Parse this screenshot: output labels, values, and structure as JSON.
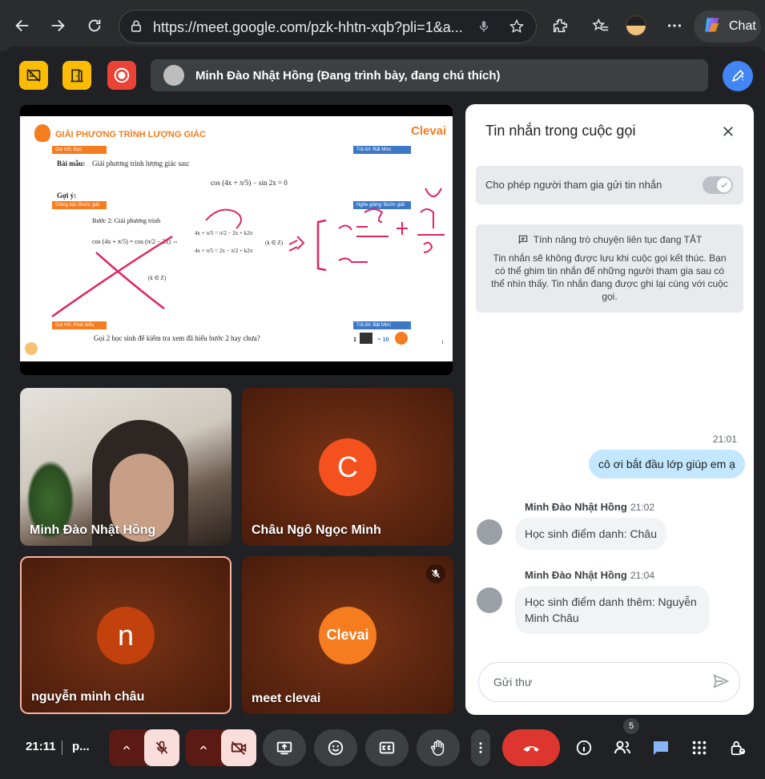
{
  "browser": {
    "url": "https://meet.google.com/pzk-hhtn-xqb?pli=1&a...",
    "copilot_label": "Chat"
  },
  "meet": {
    "presenter_text": "Minh Đào Nhật Hồng (Đang trình bày, đang chú thích)"
  },
  "slide": {
    "title": "GIẢI PHƯƠNG TRÌNH LƯỢNG GIÁC",
    "brand": "Clevai",
    "tag_goi_hs_doc": "Gọi HS: Đọc",
    "tag_tra_loi_rat_muc": "Trả lời: Rất Mức",
    "bai_mau_label": "Bài mẫu:",
    "bai_mau_text": "Giải phương trình lượng giác sau:",
    "equation": "cos (4x + π/5) − sin 2x = 0",
    "goi_y": "Gợi ý:",
    "tag_giang_bai": "Giảng bài: Bước giải",
    "tag_nghe_giang": "Nghe giảng: Bước giải",
    "step2": "Bước 2: Giải phương trình",
    "line1": "cos (4x + π/5) = cos (π/2 − 2x) ⇔",
    "case1": "4x + π/5 = π/2 − 2x + k2π",
    "case2": "4x + π/5 = 2x − π/2 + k2π",
    "k_in_z1": "(k ∈ Z)",
    "k_in_z2": "(k ∈ Z)",
    "tag_phat_bieu": "Gọi HS: Phát biểu",
    "tag_tra_loi_bat_muc": "Trả lời: Bật Mức",
    "question": "Gọi 2 học sinh để kiểm tra xem đã hiểu bước 2 hay chưa?",
    "score_left": "1",
    "score_right": "= 10",
    "page_num": "1"
  },
  "tiles": [
    {
      "name": "Minh Đào Nhật Hồng"
    },
    {
      "name": "Châu Ngô Ngọc Minh",
      "initial": "C"
    },
    {
      "name": "nguyễn minh châu",
      "initial": "n"
    },
    {
      "name": "meet clevai",
      "logo_text": "Clevai"
    }
  ],
  "chat": {
    "title": "Tin nhắn trong cuộc gọi",
    "allow_label": "Cho phép người tham gia gửi tin nhắn",
    "info_title": "Tính năng trò chuyện liên tục đang TẮT",
    "info_body": "Tin nhắn sẽ không được lưu khi cuộc gọi kết thúc. Bạn có thể ghim tin nhắn để những người tham gia sau có thể nhìn thấy. Tin nhắn đang được ghi lại cùng với cuộc gọi.",
    "messages": [
      {
        "time": "21:01",
        "text": "cô ơi bắt đầu lớp giúp em ạ"
      },
      {
        "sender": "Minh Đào Nhật Hồng",
        "time": "21:02",
        "text": "Học sinh điểm danh: Châu"
      },
      {
        "sender": "Minh Đào Nhật Hồng",
        "time": "21:04",
        "text": "Học sinh điểm danh thêm: Nguyễn Minh Châu"
      }
    ],
    "input_placeholder": "Gửi thư"
  },
  "bottom": {
    "clock": "21:11",
    "meet_code": "p...",
    "people_count": "5"
  },
  "colors": {
    "accent_yellow": "#fbbc04",
    "record_red": "#ea4335",
    "leave_red": "#dc362e",
    "pen_blue": "#4285f4",
    "bubble_out": "#c2e7ff",
    "clevai_orange": "#f57c1f"
  }
}
